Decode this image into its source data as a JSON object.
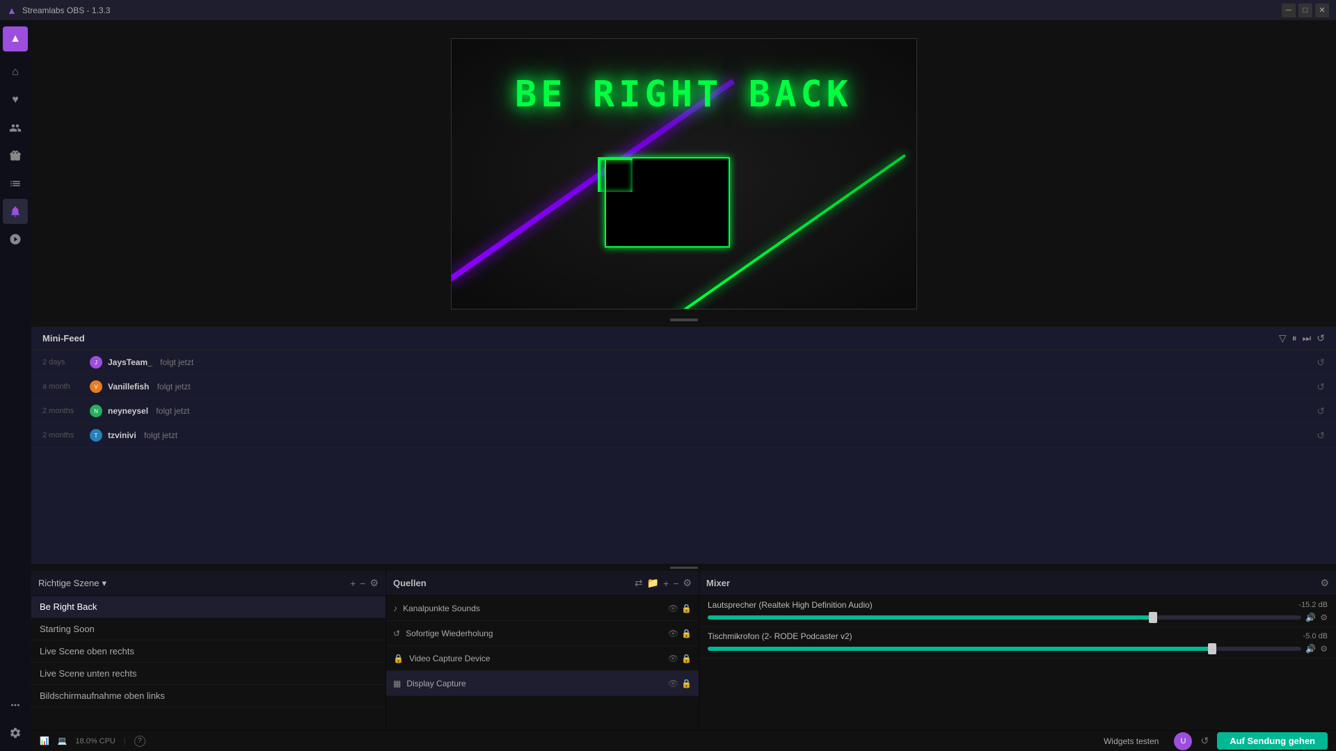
{
  "titlebar": {
    "title": "Streamlabs OBS - 1.3.3",
    "controls": [
      "─",
      "□",
      "✕"
    ]
  },
  "sidebar": {
    "icons": [
      {
        "name": "brand",
        "symbol": "▲",
        "label": "brand-logo",
        "active": false
      },
      {
        "name": "home",
        "symbol": "⌂",
        "label": "home",
        "active": false
      },
      {
        "name": "followers",
        "symbol": "♥",
        "label": "followers",
        "active": false
      },
      {
        "name": "users",
        "symbol": "👥",
        "label": "users",
        "active": false
      },
      {
        "name": "gift",
        "symbol": "🎁",
        "label": "gift",
        "active": false
      },
      {
        "name": "chart",
        "symbol": "📈",
        "label": "analytics",
        "active": false
      },
      {
        "name": "notification",
        "symbol": "🔔",
        "label": "notifications",
        "active": true
      },
      {
        "name": "settings-top",
        "symbol": "⚙",
        "label": "settings-top",
        "active": false
      }
    ],
    "bottom_icons": [
      {
        "name": "dots",
        "symbol": "⋮",
        "label": "more"
      },
      {
        "name": "settings",
        "symbol": "⚙",
        "label": "settings"
      },
      {
        "name": "user",
        "symbol": "👤",
        "label": "profile"
      }
    ]
  },
  "minifeed": {
    "title": "Mini-Feed",
    "items": [
      {
        "time": "2 days",
        "user": "JaysTeam_",
        "action": "folgt jetzt",
        "avatar": "J"
      },
      {
        "time": "a month",
        "user": "Vanillefish",
        "action": "folgt jetzt",
        "avatar": "V"
      },
      {
        "time": "2 months",
        "user": "neyneysel",
        "action": "folgt jetzt",
        "avatar": "N"
      },
      {
        "time": "2 months",
        "user": "tzvinivi",
        "action": "folgt jetzt",
        "avatar": "T"
      }
    ]
  },
  "scenes": {
    "title": "Richtige Szene",
    "dropdown_arrow": "▾",
    "add_label": "+",
    "remove_label": "−",
    "settings_label": "⚙",
    "items": [
      {
        "label": "Be Right Back",
        "active": true
      },
      {
        "label": "Starting Soon",
        "active": false
      },
      {
        "label": "Live Scene oben rechts",
        "active": false
      },
      {
        "label": "Live Scene unten rechts",
        "active": false
      },
      {
        "label": "Bildschirmaufnahme oben links",
        "active": false
      }
    ]
  },
  "sources": {
    "title": "Quellen",
    "add_label": "+",
    "remove_label": "−",
    "settings_label": "⚙",
    "items": [
      {
        "label": "Kanalpunkte Sounds",
        "icon": "♪",
        "active": false
      },
      {
        "label": "Sofortige Wiederholung",
        "icon": "↺",
        "active": false
      },
      {
        "label": "Video Capture Device",
        "icon": "🔒",
        "active": false
      },
      {
        "label": "Display Capture",
        "icon": "▦",
        "active": true
      }
    ]
  },
  "mixer": {
    "title": "Mixer",
    "settings_label": "⚙",
    "channels": [
      {
        "name": "Lautsprecher (Realtek High Definition Audio)",
        "db": "-15.2 dB",
        "fill_pct": 75,
        "thumb_pct": 75
      },
      {
        "name": "Tischmikrofon (2- RODE Podcaster v2)",
        "db": "-5.0 dB",
        "fill_pct": 85,
        "thumb_pct": 85
      }
    ]
  },
  "statusbar": {
    "chart_icon": "📊",
    "cpu_icon": "💻",
    "cpu_label": "18.0% CPU",
    "help_icon": "?",
    "test_widgets_label": "Widgets testen",
    "go_live_label": "Auf Sendung gehen"
  }
}
